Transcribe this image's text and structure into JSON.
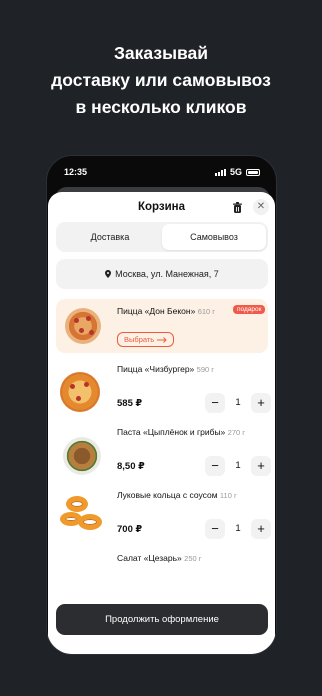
{
  "promo": {
    "lines": [
      "Заказывай",
      "доставку или самовывоз",
      "в несколько кликов"
    ]
  },
  "status": {
    "time": "12:35",
    "network": "5G"
  },
  "cart": {
    "title": "Корзина",
    "icons": {
      "trash": "trash-icon",
      "close": "close-icon"
    },
    "tabs": [
      {
        "label": "Доставка",
        "selected": false
      },
      {
        "label": "Самовывоз",
        "selected": true
      }
    ],
    "address": "Москва, ул. Манежная, 7",
    "items": [
      {
        "name": "Пицца «Дон Бекон»",
        "weight": "610 г",
        "badge": "подарок",
        "action": "Выбрать"
      },
      {
        "name": "Пицца «Чизбургер»",
        "weight": "590 г",
        "price": "585 ₽",
        "qty": "1"
      },
      {
        "name": "Паста «Цыплёнок и грибы»",
        "weight": "270 г",
        "price": "8,50 ₽",
        "qty": "1"
      },
      {
        "name": "Луковые кольца с соусом",
        "weight": "110 г",
        "price": "700 ₽",
        "qty": "1"
      },
      {
        "name": "Салат «Цезарь»",
        "weight": "250 г"
      }
    ],
    "stepper": {
      "minus": "−",
      "plus": "+"
    },
    "continue_label": "Продолжить оформление"
  },
  "colors": {
    "background": "#1f2226",
    "accent": "#f05a3c",
    "gift_bg": "#fdf1e6",
    "button": "#2c2d30"
  }
}
